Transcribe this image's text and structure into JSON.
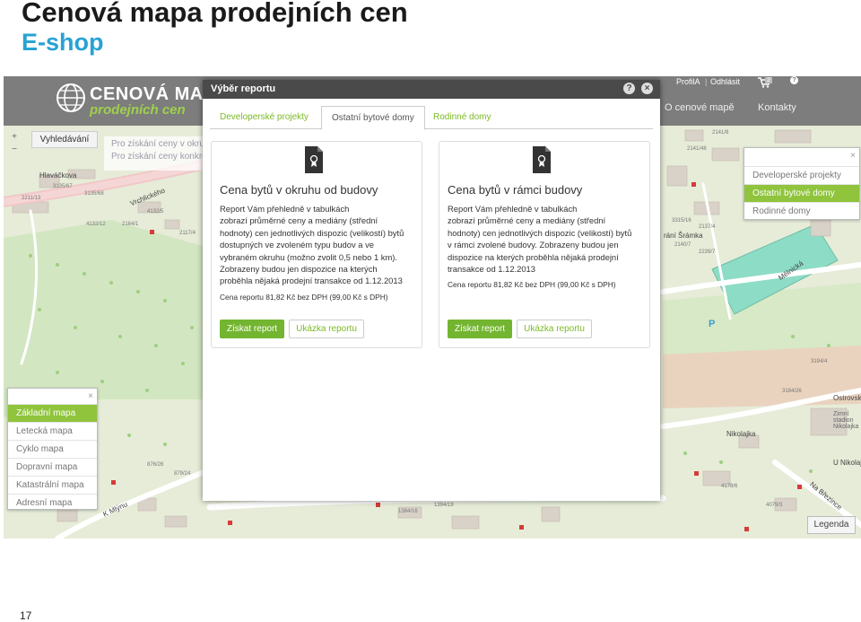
{
  "slide": {
    "title": "Cenová mapa prodejních cen",
    "subtitle": "E-shop",
    "page_number": "17"
  },
  "header": {
    "logo_title": "CENOVÁ MAPA",
    "logo_subtitle": "prodejních cen",
    "profile_link": "ProfilA",
    "logout_link": "Odhlásit",
    "cart_count": "2",
    "help_icon": "?",
    "nav_about": "O cenové mapě",
    "nav_contacts": "Kontakty"
  },
  "map": {
    "search_button": "Vyhledávání",
    "info_line1": "Pro získání ceny v okruh",
    "info_line2": "Pro získání ceny konkrét",
    "zoom_in": "+",
    "zoom_out": "−",
    "legend_button": "Legenda",
    "street_labels": [
      "Hlaváčkova",
      "Vrchlického",
      "Mělnická",
      "Ostrovsk",
      "Nikolajka",
      "U Nikolaj",
      "Na Březince",
      "K Mlýnu",
      "Zimní stadion Nikolajka",
      "rání Šrámka",
      "P"
    ],
    "parcel_labels": [
      "2141/8",
      "2141/48",
      "3135/67",
      "3135/68",
      "2211/13",
      "4132/5",
      "4132/12",
      "2164/1",
      "2117/4",
      "2118/4",
      "1917/4",
      "1905/7",
      "1834/5",
      "218/60",
      "2207/4",
      "3315/16",
      "2140/7",
      "2137/4",
      "2239/7",
      "2232/36",
      "3194/4",
      "3184/26",
      "4178/6",
      "4079/3",
      "3138/9",
      "3215/9",
      "876/26",
      "879/24",
      "3140/3",
      "3147/16",
      "1384/16",
      "1394/19"
    ]
  },
  "layer_panel": {
    "items": [
      "Základní mapa",
      "Letecká mapa",
      "Cyklo mapa",
      "Dopravní mapa",
      "Katastrální mapa",
      "Adresní mapa"
    ],
    "active_index": 0,
    "close_icon": "×"
  },
  "category_panel": {
    "items": [
      "Developerské projekty",
      "Ostatní bytové domy",
      "Rodinné domy"
    ],
    "active_index": 1,
    "close_icon": "×"
  },
  "modal": {
    "title": "Výběr reportu",
    "help_icon": "?",
    "close_icon": "×",
    "tabs": [
      {
        "label": "Developerské projekty",
        "active": false
      },
      {
        "label": "Ostatní bytové domy",
        "active": true
      },
      {
        "label": "Rodinné domy",
        "active": false
      }
    ],
    "cards": [
      {
        "title": "Cena bytů v okruhu od budovy",
        "lines": [
          "Report Vám přehledně v tabulkách",
          "zobrazí průměrné ceny a mediány (střední",
          "hodnoty) cen jednotlivých dispozic (velikostí) bytů",
          "dostupných ve zvoleném typu budov a ve",
          "vybraném okruhu (možno zvolit 0,5 nebo 1 km).",
          "Zobrazeny budou jen dispozice na kterých",
          "proběhla nějaká prodejní transakce od 1.12.2013"
        ],
        "price": "Cena reportu 81,82 Kč bez DPH (99,00 Kč s DPH)",
        "buy_button": "Získat report",
        "sample_button": "Ukázka reportu"
      },
      {
        "title": "Cena bytů v rámci budovy",
        "lines": [
          "Report Vám přehledně v tabulkách",
          "zobrazí průměrné ceny a mediány (střední",
          "hodnoty) cen jednotlivých dispozic (velikostí) bytů",
          "v rámci zvolené budovy. Zobrazeny budou jen",
          "dispozice na kterých proběhla nějaká prodejní",
          "transakce od 1.12.2013"
        ],
        "price": "Cena reportu 81,82 Kč bez DPH (99,00 Kč s DPH)",
        "buy_button": "Získat report",
        "sample_button": "Ukázka reportu"
      }
    ]
  },
  "colors": {
    "accent_green": "#73b530",
    "header_gray": "#7d7d7d",
    "modal_header": "#4a4a4a",
    "subtitle_blue": "#27a3d3"
  }
}
